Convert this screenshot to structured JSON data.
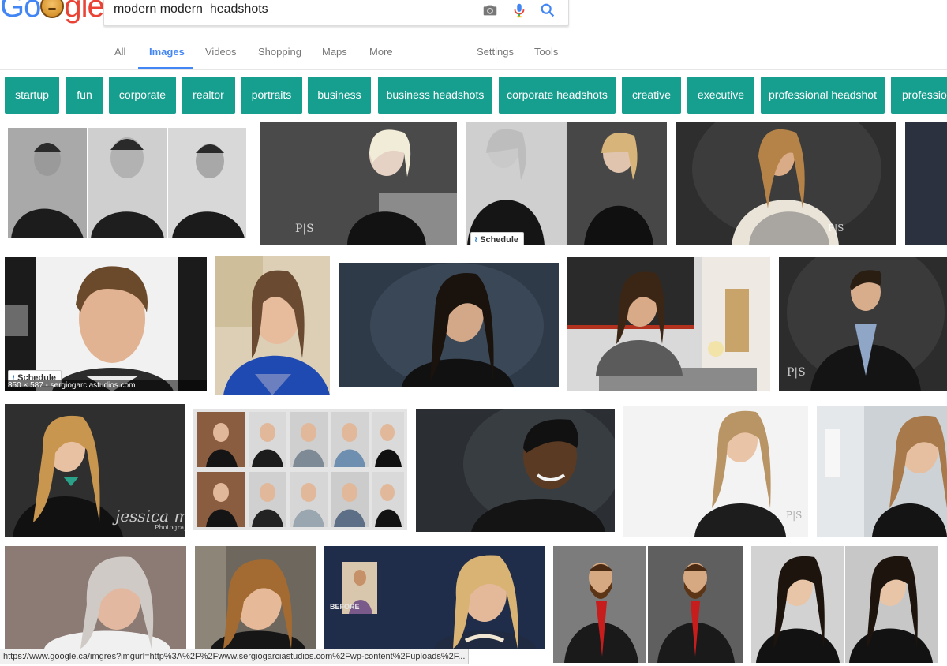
{
  "logo": {
    "text_pre": "Go",
    "text_post": "gle"
  },
  "search": {
    "query": "modern modern  headshots"
  },
  "nav": {
    "tabs": [
      "All",
      "Images",
      "Videos",
      "Shopping",
      "Maps",
      "More"
    ],
    "active": "Images",
    "settings": "Settings",
    "tools": "Tools"
  },
  "chips": [
    "startup",
    "fun",
    "corporate",
    "realtor",
    "portraits",
    "business",
    "business headshots",
    "corporate headshots",
    "creative",
    "executive",
    "professional headshot",
    "profession"
  ],
  "badges": {
    "schedule": "Schedule"
  },
  "captions": {
    "dimensions": "850 × 587 - sergiogarciastudios.com"
  },
  "watermarks": {
    "jessica": "jessica micha",
    "jessica_sub": "Photography",
    "ps": "P|S",
    "befor": "BEFORE"
  },
  "status_url": "https://www.google.ca/imgres?imgurl=http%3A%2F%2Fwww.sergiogarciastudios.com%2Fwp-content%2Fuploads%2F...",
  "colors": {
    "chip": "#169e8e",
    "active_tab": "#4285f4"
  }
}
